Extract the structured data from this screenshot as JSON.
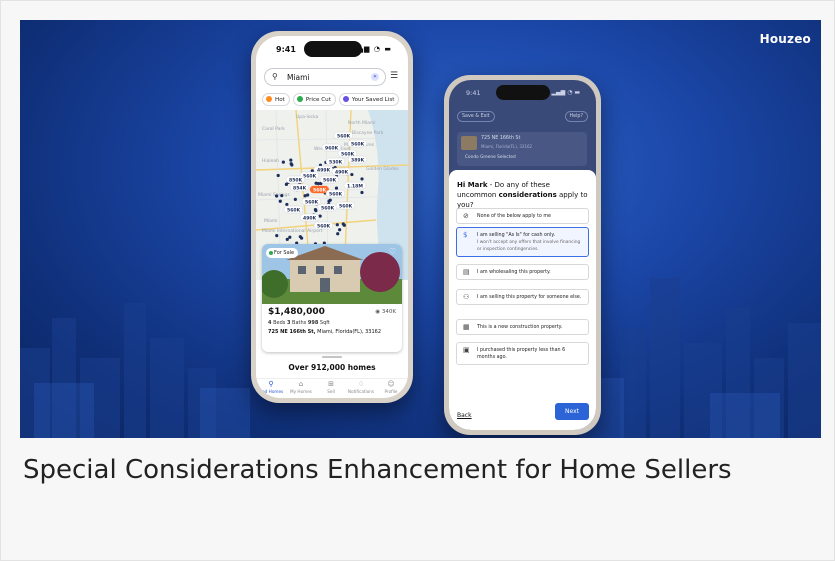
{
  "brand": {
    "name": "Houzeo"
  },
  "caption": "Special Considerations Enhancement for Home Sellers",
  "phone1": {
    "time": "9:41",
    "search_value": "Miami",
    "chips": [
      {
        "label": "Hot",
        "color": "#ff8a1f"
      },
      {
        "label": "Price Cut",
        "color": "#2dab4f"
      },
      {
        "label": "Your Saved List",
        "color": "#6a4fe0"
      }
    ],
    "map_labels": [
      "Upa-locka",
      "Hialeah",
      "West Little River",
      "Miami Shores",
      "North Miami",
      "Biscayne Park",
      "Miami",
      "Miami International Airport",
      "Miami Springs",
      "Golden Glades",
      "Carol Park"
    ],
    "map_prices": [
      "560K",
      "560K",
      "960K",
      "560K",
      "530K",
      "389K",
      "499K",
      "490K",
      "560K",
      "850K",
      "560K",
      "854K",
      "1.18M",
      "560K",
      "560K",
      "560K",
      "560K",
      "560K",
      "560K",
      "490K",
      "560K"
    ],
    "listing": {
      "badge": "For Sale",
      "price": "$1,480,000",
      "views": "340K",
      "beds": "4",
      "beds_label": "Beds",
      "baths": "3",
      "baths_label": "Baths",
      "sqft": "998",
      "sqft_label": "Sqft",
      "address_street": "725 NE 166th St,",
      "address_rest": "Miami, Florida(FL), 33162"
    },
    "summary": "Over 912,000 homes",
    "tabs": [
      {
        "label": "Find Homes",
        "icon": "search-icon"
      },
      {
        "label": "My Homes",
        "icon": "home-icon"
      },
      {
        "label": "Sell",
        "icon": "plus-icon"
      },
      {
        "label": "Notifications",
        "icon": "bell-icon"
      },
      {
        "label": "Profile",
        "icon": "user-icon"
      }
    ]
  },
  "phone2": {
    "time": "9:41",
    "save_exit": "Save & Exit",
    "help": "Help?",
    "dim_address": "725 NE 166th St",
    "dim_sub": "Miami, Florida(FL), 33162",
    "dim_selected": "Condo Greene Selected",
    "question_name": "Hi Mark",
    "question_before": "- Do any of these uncommon",
    "question_bold": "considerations",
    "question_after": "apply to you?",
    "options": [
      {
        "title": "None of the below apply to me",
        "sub": "",
        "icon": "ban-icon",
        "selected": false
      },
      {
        "title": "I am selling \"As Is\" for cash only.",
        "sub": "I won't accept any offers that involve financing or inspection contingencies.",
        "icon": "cash-icon",
        "selected": true
      },
      {
        "title": "I am wholesaling this property.",
        "sub": "",
        "icon": "document-icon",
        "selected": false
      },
      {
        "title": "I am selling this property for someone else.",
        "sub": "",
        "icon": "handshake-icon",
        "selected": false
      },
      {
        "title": "This is a new construction property.",
        "sub": "",
        "icon": "building-icon",
        "selected": false
      },
      {
        "title": "I purchased this property less than 6 months ago.",
        "sub": "",
        "icon": "calendar-icon",
        "selected": false
      }
    ],
    "back": "Back",
    "next": "Next"
  }
}
